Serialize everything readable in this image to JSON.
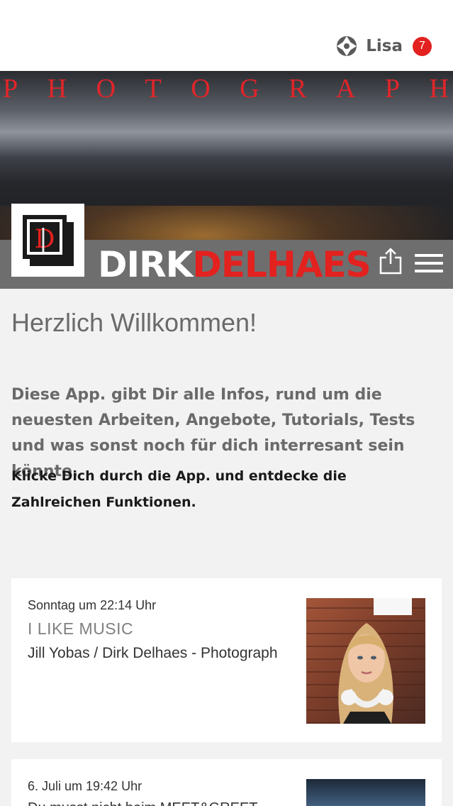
{
  "header": {
    "user_name": "Lisa",
    "notification_count": "7"
  },
  "banner": {
    "photograph_letters": [
      "P",
      "H",
      "O",
      "T",
      "O",
      "G",
      "R",
      "A",
      "P",
      "H"
    ],
    "brand_first": "DIRK",
    "brand_last": "DELHAES",
    "logo_letters": "DD"
  },
  "main": {
    "welcome_title": "Herzlich Willkommen!",
    "intro_text": "Diese App. gibt Dir alle Infos, rund um die neuesten Arbeiten, Angebote, Tutorials, Tests und was sonst noch für dich interresant sein könnte.",
    "cta_text": "Klicke Dich durch die App. und entdecke die Zahlreichen Funktionen."
  },
  "feed": [
    {
      "date": "Sonntag um 22:14 Uhr",
      "title": "I LIKE MUSIC",
      "subtitle": "Jill Yobas / Dirk Delhaes - Photograph"
    },
    {
      "date": "6. Juli um 19:42 Uhr",
      "title": "Du musst nicht beim MEET&GREET ..."
    }
  ],
  "colors": {
    "accent_red": "#e3211f",
    "brand_bar_gray": "#6e6e6e",
    "text_gray": "#6a6a6a"
  },
  "icons": {
    "user": "aperture-icon",
    "share": "share-icon",
    "menu": "hamburger-menu-icon"
  }
}
